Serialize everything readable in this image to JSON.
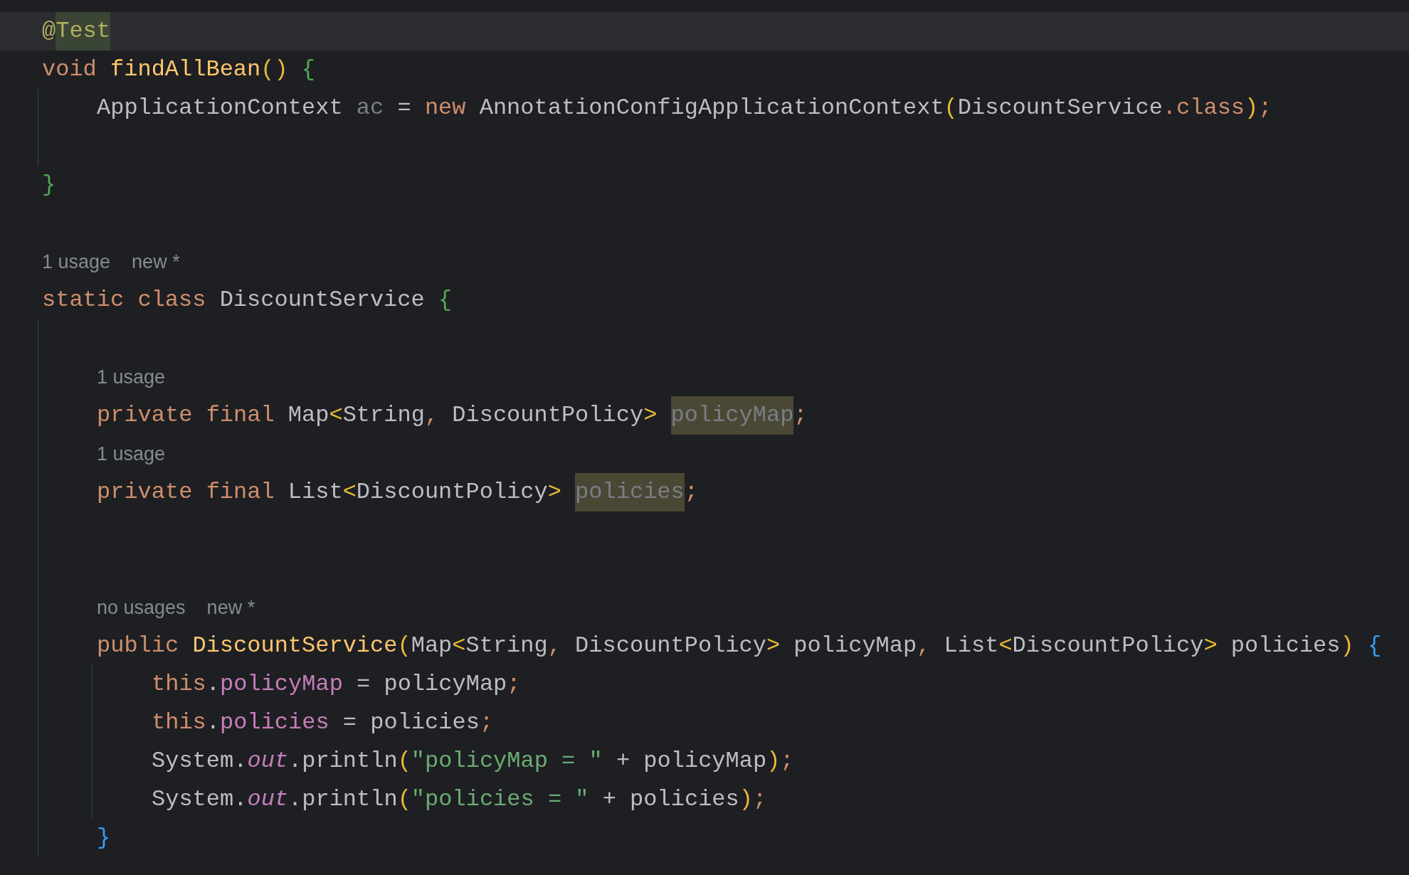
{
  "editor": {
    "lines": [
      {
        "kind": "code",
        "current": true,
        "tokens": [
          {
            "kind": "annot",
            "text": "@"
          },
          {
            "kind": "annot-hl",
            "text": "Test"
          }
        ]
      },
      {
        "kind": "code",
        "current": false,
        "tokens": [
          {
            "kind": "kw",
            "text": "void"
          },
          {
            "kind": "fn",
            "text": " findAllBean"
          },
          {
            "kind": "paren",
            "text": "()"
          },
          {
            "kind": "brace-green",
            "text": " {"
          }
        ]
      },
      {
        "kind": "block",
        "children": [
          {
            "kind": "code",
            "current": false,
            "tokens": [
              {
                "kind": "plain",
                "text": "ApplicationContext "
              },
              {
                "kind": "unused",
                "text": "ac"
              },
              {
                "kind": "plain",
                "text": " = "
              },
              {
                "kind": "kw",
                "text": "new"
              },
              {
                "kind": "plain",
                "text": " AnnotationConfigApplicationContext"
              },
              {
                "kind": "paren",
                "text": "("
              },
              {
                "kind": "plain",
                "text": "DiscountService"
              },
              {
                "kind": "kw",
                "text": ".class"
              },
              {
                "kind": "paren",
                "text": ")"
              },
              {
                "kind": "punct",
                "text": ";"
              }
            ]
          },
          {
            "kind": "blank"
          }
        ]
      },
      {
        "kind": "code",
        "current": false,
        "tokens": [
          {
            "kind": "brace-green",
            "text": "}"
          }
        ]
      },
      {
        "kind": "blank"
      },
      {
        "kind": "hint",
        "hints": [
          "1 usage",
          "new *"
        ]
      },
      {
        "kind": "code",
        "current": false,
        "tokens": [
          {
            "kind": "kw",
            "text": "static"
          },
          {
            "kind": "kw",
            "text": " class"
          },
          {
            "kind": "plain",
            "text": " DiscountService "
          },
          {
            "kind": "brace-green",
            "text": "{"
          }
        ]
      },
      {
        "kind": "block",
        "children": [
          {
            "kind": "blank"
          },
          {
            "kind": "hint",
            "hints": [
              "1 usage"
            ]
          },
          {
            "kind": "code",
            "current": false,
            "tokens": [
              {
                "kind": "kw",
                "text": "private final"
              },
              {
                "kind": "plain",
                "text": " Map"
              },
              {
                "kind": "paren",
                "text": "<"
              },
              {
                "kind": "plain",
                "text": "String"
              },
              {
                "kind": "punct",
                "text": ","
              },
              {
                "kind": "plain",
                "text": " DiscountPolicy"
              },
              {
                "kind": "paren",
                "text": "> "
              },
              {
                "kind": "unused-hl",
                "text": "policyMap"
              },
              {
                "kind": "punct",
                "text": ";"
              }
            ]
          },
          {
            "kind": "hint",
            "hints": [
              "1 usage"
            ]
          },
          {
            "kind": "code",
            "current": false,
            "tokens": [
              {
                "kind": "kw",
                "text": "private final"
              },
              {
                "kind": "plain",
                "text": " List"
              },
              {
                "kind": "paren",
                "text": "<"
              },
              {
                "kind": "plain",
                "text": "DiscountPolicy"
              },
              {
                "kind": "paren",
                "text": "> "
              },
              {
                "kind": "unused-hl",
                "text": "policies"
              },
              {
                "kind": "punct",
                "text": ";"
              }
            ]
          },
          {
            "kind": "blank"
          },
          {
            "kind": "blank"
          },
          {
            "kind": "hint",
            "hints": [
              "no usages",
              "new *"
            ]
          },
          {
            "kind": "code",
            "current": false,
            "tokens": [
              {
                "kind": "kw",
                "text": "public"
              },
              {
                "kind": "fn",
                "text": " DiscountService"
              },
              {
                "kind": "paren",
                "text": "("
              },
              {
                "kind": "plain",
                "text": "Map"
              },
              {
                "kind": "paren",
                "text": "<"
              },
              {
                "kind": "plain",
                "text": "String"
              },
              {
                "kind": "punct",
                "text": ","
              },
              {
                "kind": "plain",
                "text": " DiscountPolicy"
              },
              {
                "kind": "paren",
                "text": ">"
              },
              {
                "kind": "plain",
                "text": " policyMap"
              },
              {
                "kind": "punct",
                "text": ","
              },
              {
                "kind": "plain",
                "text": " List"
              },
              {
                "kind": "paren",
                "text": "<"
              },
              {
                "kind": "plain",
                "text": "DiscountPolicy"
              },
              {
                "kind": "paren",
                "text": ">"
              },
              {
                "kind": "plain",
                "text": " policies"
              },
              {
                "kind": "paren",
                "text": ")"
              },
              {
                "kind": "brace-blue",
                "text": " {"
              }
            ]
          },
          {
            "kind": "block",
            "children": [
              {
                "kind": "code",
                "current": false,
                "tokens": [
                  {
                    "kind": "kw",
                    "text": "this"
                  },
                  {
                    "kind": "plain",
                    "text": "."
                  },
                  {
                    "kind": "field",
                    "text": "policyMap"
                  },
                  {
                    "kind": "plain",
                    "text": " = policyMap"
                  },
                  {
                    "kind": "punct",
                    "text": ";"
                  }
                ]
              },
              {
                "kind": "code",
                "current": false,
                "tokens": [
                  {
                    "kind": "kw",
                    "text": "this"
                  },
                  {
                    "kind": "plain",
                    "text": "."
                  },
                  {
                    "kind": "field",
                    "text": "policies"
                  },
                  {
                    "kind": "plain",
                    "text": " = policies"
                  },
                  {
                    "kind": "punct",
                    "text": ";"
                  }
                ]
              },
              {
                "kind": "code",
                "current": false,
                "tokens": [
                  {
                    "kind": "plain",
                    "text": "System."
                  },
                  {
                    "kind": "static",
                    "text": "out"
                  },
                  {
                    "kind": "plain",
                    "text": ".println"
                  },
                  {
                    "kind": "paren",
                    "text": "("
                  },
                  {
                    "kind": "string",
                    "text": "\"policyMap = \""
                  },
                  {
                    "kind": "plain",
                    "text": " + policyMap"
                  },
                  {
                    "kind": "paren",
                    "text": ")"
                  },
                  {
                    "kind": "punct",
                    "text": ";"
                  }
                ]
              },
              {
                "kind": "code",
                "current": false,
                "tokens": [
                  {
                    "kind": "plain",
                    "text": "System."
                  },
                  {
                    "kind": "static",
                    "text": "out"
                  },
                  {
                    "kind": "plain",
                    "text": ".println"
                  },
                  {
                    "kind": "paren",
                    "text": "("
                  },
                  {
                    "kind": "string",
                    "text": "\"policies = \""
                  },
                  {
                    "kind": "plain",
                    "text": " + policies"
                  },
                  {
                    "kind": "paren",
                    "text": ")"
                  },
                  {
                    "kind": "punct",
                    "text": ";"
                  }
                ]
              }
            ]
          },
          {
            "kind": "code",
            "current": false,
            "tokens": [
              {
                "kind": "brace-blue",
                "text": "}"
              }
            ]
          }
        ]
      }
    ]
  }
}
